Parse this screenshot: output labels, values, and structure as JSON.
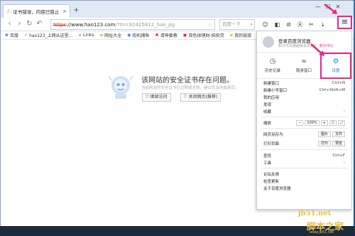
{
  "tab": {
    "title": "证书错误，内容已阻止",
    "close": "×"
  },
  "new_tab": "+",
  "window_controls": {
    "min": "—",
    "max": "☐",
    "close": "✕"
  },
  "nav": {
    "url_scheme": "https",
    "url_host": "://www.hao123.com",
    "url_path": "/?tn=92425812_hao_pg",
    "search_placeholder": "百度一下"
  },
  "bookmarks": [
    {
      "label": "百度",
      "icon": "paw-icon"
    },
    {
      "label": "hao123_上网从这里...",
      "icon": "leaf-icon"
    },
    {
      "label": "Links",
      "icon": "folder-icon"
    },
    {
      "label": "网址大全",
      "icon": "grid-icon"
    },
    {
      "label": "街机捕鱼",
      "icon": "game-icon"
    },
    {
      "label": "请神黄蓉",
      "icon": "pin-icon"
    },
    {
      "label": "双色球理财-拍拍贷",
      "icon": "ball-icon"
    },
    {
      "label": "我的链接",
      "icon": "folder-icon"
    }
  ],
  "error": {
    "title": "该网站的安全证书存在问题。",
    "subtitle": "当前网站的安全证书已过期或无效，建议您关闭此网页。",
    "continue_btn": "继续访问",
    "close_btn": "关闭网页(推荐)"
  },
  "menu": {
    "user_name": "登录百度浏览器",
    "user_sub_prefix": "积分可兑换超级会员VIP，",
    "user_sub_link": "积分中心",
    "tiles": [
      {
        "label": "历史记录",
        "icon": "clock-icon"
      },
      {
        "label": "隐身窗口",
        "icon": "mask-icon"
      },
      {
        "label": "设置",
        "icon": "gear-icon"
      }
    ],
    "new_window": {
      "label": "新建窗口",
      "shortcut": "Ctrl+N"
    },
    "new_private": {
      "label": "新建小号窗口",
      "shortcut": "Ctrl+Shift+M"
    },
    "my_apps": "我的应用",
    "discover": "发现",
    "favorites": "收藏",
    "zoom": {
      "label": "缩放",
      "minus": "−",
      "value": "100%",
      "plus": "+"
    },
    "save_as": {
      "label": "网页另存为",
      "opt1": "图片",
      "opt2": "文件"
    },
    "print": {
      "label": "打印页面",
      "opt1": "打印",
      "opt2": "预览"
    },
    "find": {
      "label": "查找",
      "shortcut": "Ctrl+F"
    },
    "tools": "工具",
    "forum": "论坛反馈",
    "check_update": "检查更新",
    "about": "关于百度浏览器"
  },
  "watermark": {
    "line1": "jb51.net",
    "line2": "脚本之家",
    "line3": "www.jb51.net"
  },
  "colors": {
    "highlight": "#e9267f",
    "accent": "#1e88e5",
    "error_red": "#d43a2f"
  }
}
